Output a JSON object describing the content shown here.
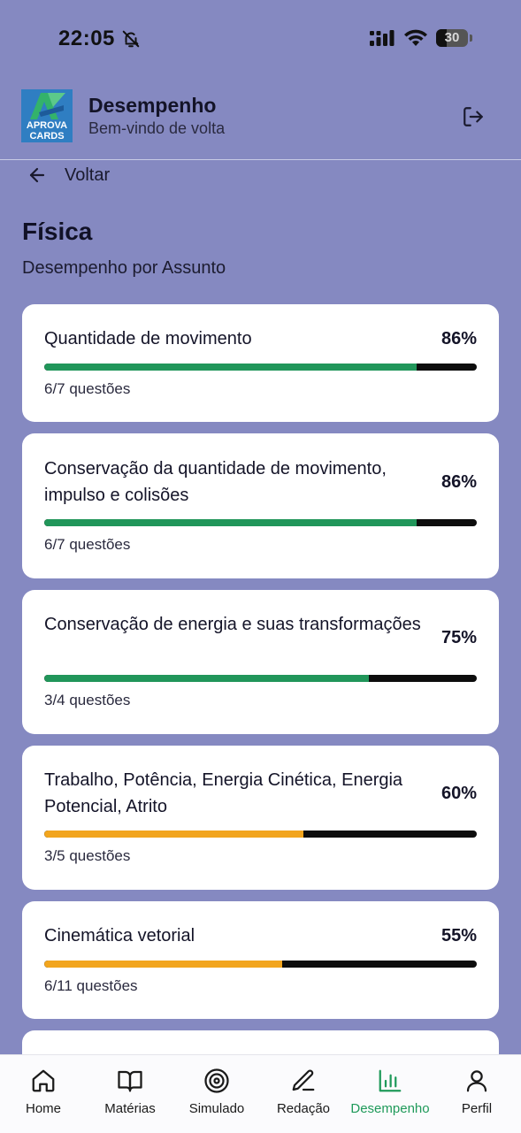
{
  "status_bar": {
    "time": "22:05",
    "battery": "30"
  },
  "header": {
    "logo_line1": "APROVA",
    "logo_line2": "CARDS",
    "title": "Desempenho",
    "subtitle": "Bem-vindo de volta"
  },
  "back_label": "Voltar",
  "subject": "Física",
  "section_title": "Desempenho por Assunto",
  "colors": {
    "good": "#21965A",
    "warning": "#F2A51E",
    "track": "#0D0D0D"
  },
  "topics": [
    {
      "title": "Quantidade de movimento",
      "percent_label": "86%",
      "progress": 0.86,
      "questions": "6/7 questões",
      "color": "#21965A"
    },
    {
      "title": "Conservação da quantidade de movimento, impulso e colisões",
      "percent_label": "86%",
      "progress": 0.86,
      "questions": "6/7 questões",
      "color": "#21965A"
    },
    {
      "title": "Conservação de energia e suas transformações",
      "percent_label": "75%",
      "progress": 0.75,
      "questions": "3/4 questões",
      "color": "#21965A"
    },
    {
      "title": "Trabalho, Potência, Energia Cinética, Energia Potencial, Atrito",
      "percent_label": "60%",
      "progress": 0.6,
      "questions": "3/5 questões",
      "color": "#F2A51E"
    },
    {
      "title": "Cinemática vetorial",
      "percent_label": "55%",
      "progress": 0.55,
      "questions": "6/11 questões",
      "color": "#F2A51E"
    }
  ],
  "nav": [
    {
      "label": "Home",
      "icon": "home-icon"
    },
    {
      "label": "Matérias",
      "icon": "book-icon"
    },
    {
      "label": "Simulado",
      "icon": "target-icon"
    },
    {
      "label": "Redação",
      "icon": "pen-icon"
    },
    {
      "label": "Desempenho",
      "icon": "bar-chart-icon",
      "active": true
    },
    {
      "label": "Perfil",
      "icon": "user-icon"
    }
  ]
}
